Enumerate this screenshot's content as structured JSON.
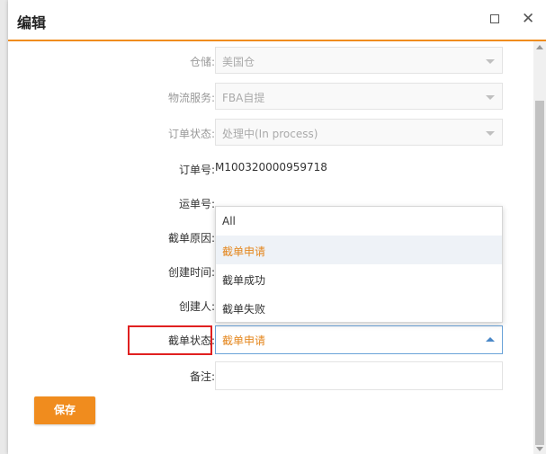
{
  "dialog": {
    "title": "编辑",
    "maximize_icon": "maximize-icon",
    "close_glyph": "✕"
  },
  "form": {
    "warehouse": {
      "label": "仓储:",
      "value": "美国仓"
    },
    "logistics": {
      "label": "物流服务:",
      "value": "FBA自提"
    },
    "order_status": {
      "label": "订单状态:",
      "value": "处理中(In process)"
    },
    "order_no": {
      "label": "订单号:",
      "value": "M100320000959718"
    },
    "waybill_no": {
      "label": "运单号:",
      "value": ""
    },
    "intercept_reason": {
      "label": "截单原因:"
    },
    "created_time": {
      "label": "创建时间:"
    },
    "creator": {
      "label": "创建人:"
    },
    "intercept_status": {
      "label": "截单状态:",
      "value": "截单申请"
    },
    "remark": {
      "label": "备注:",
      "value": ""
    }
  },
  "dropdown": {
    "options": [
      "All",
      "截单申请",
      "截单成功",
      "截单失败"
    ],
    "selected": "截单申请"
  },
  "buttons": {
    "save": "保存"
  },
  "colors": {
    "accent": "#f08c1e",
    "selected_text": "#e4861c",
    "highlight_box": "#e02020"
  }
}
